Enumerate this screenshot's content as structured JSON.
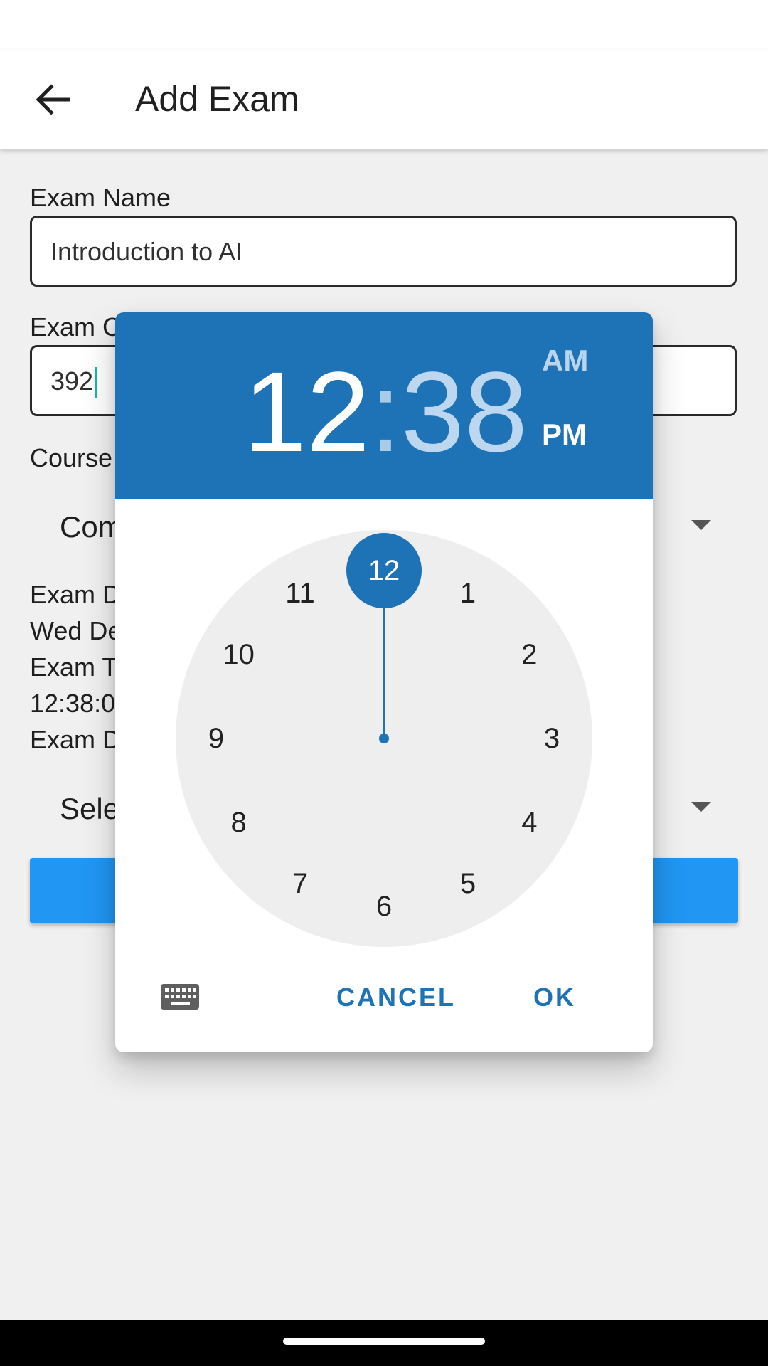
{
  "app_bar": {
    "title": "Add Exam"
  },
  "form": {
    "exam_name_label": "Exam Name",
    "exam_name_value": "Introduction to AI",
    "exam_code_label": "Exam C",
    "exam_code_value": "392",
    "course_label": "Course",
    "course_value": "Com",
    "exam_date_label": "Exam D",
    "exam_date_value": "Wed De",
    "exam_time_label": "Exam T",
    "exam_time_value": "12:38:0",
    "exam_duration_label": "Exam D",
    "duration_value": "Sele"
  },
  "time_picker": {
    "hour": "12",
    "separator": ":",
    "minute": "38",
    "am_label": "AM",
    "pm_label": "PM",
    "selected_period": "PM",
    "selected_hour": 12,
    "dial_numbers": [
      "12",
      "1",
      "2",
      "3",
      "4",
      "5",
      "6",
      "7",
      "8",
      "9",
      "10",
      "11"
    ],
    "cancel_label": "CANCEL",
    "ok_label": "OK",
    "keyboard_icon": "keyboard-icon"
  },
  "colors": {
    "accent": "#1e73b6",
    "primary_button": "#2196f3",
    "dial_face": "#eeeeee",
    "caret": "#18b8a8"
  }
}
